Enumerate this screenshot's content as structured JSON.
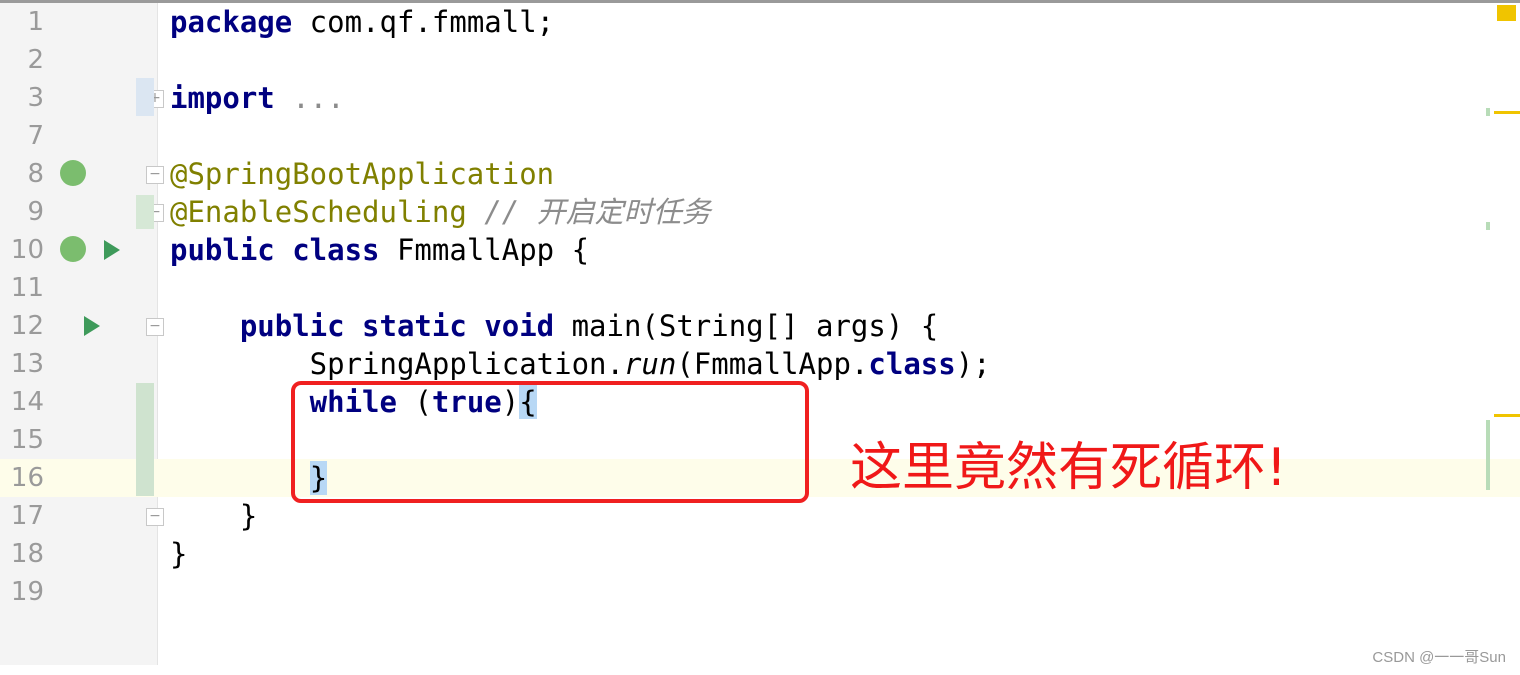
{
  "editor": {
    "lines": [
      {
        "n": "1",
        "tokens": [
          {
            "t": "package",
            "c": "kw"
          },
          {
            "t": " com.qf.fmmall;",
            "c": ""
          }
        ]
      },
      {
        "n": "2",
        "tokens": []
      },
      {
        "n": "3",
        "tokens": [
          {
            "t": "import",
            "c": "kw"
          },
          {
            "t": " ...",
            "c": "fold"
          }
        ]
      },
      {
        "n": "7",
        "tokens": []
      },
      {
        "n": "8",
        "tokens": [
          {
            "t": "@SpringBootApplication",
            "c": "ann"
          }
        ]
      },
      {
        "n": "9",
        "tokens": [
          {
            "t": "@EnableScheduling",
            "c": "ann"
          },
          {
            "t": " // 开启定时任务",
            "c": "cm"
          }
        ]
      },
      {
        "n": "10",
        "tokens": [
          {
            "t": "public class",
            "c": "kw"
          },
          {
            "t": " FmmallApp {",
            "c": ""
          }
        ]
      },
      {
        "n": "11",
        "tokens": []
      },
      {
        "n": "12",
        "tokens": [
          {
            "t": "    public static void",
            "c": "kw"
          },
          {
            "t": " main(String[] args) {",
            "c": ""
          }
        ]
      },
      {
        "n": "13",
        "tokens": [
          {
            "t": "        SpringApplication.",
            "c": ""
          },
          {
            "t": "run",
            "c": "it"
          },
          {
            "t": "(FmmallApp.",
            "c": ""
          },
          {
            "t": "class",
            "c": "kw"
          },
          {
            "t": ");",
            "c": ""
          }
        ]
      },
      {
        "n": "14",
        "tokens": [
          {
            "t": "        while",
            "c": "kw"
          },
          {
            "t": " (",
            "c": ""
          },
          {
            "t": "true",
            "c": "kw"
          },
          {
            "t": ")",
            "c": ""
          },
          {
            "t": "{",
            "c": "brace"
          }
        ]
      },
      {
        "n": "15",
        "tokens": []
      },
      {
        "n": "16",
        "tokens": [
          {
            "t": "        ",
            "c": ""
          },
          {
            "t": "}",
            "c": "brace"
          }
        ]
      },
      {
        "n": "17",
        "tokens": [
          {
            "t": "    }",
            "c": ""
          }
        ]
      },
      {
        "n": "18",
        "tokens": [
          {
            "t": "}",
            "c": ""
          }
        ]
      },
      {
        "n": "19",
        "tokens": []
      }
    ],
    "current_line": "16"
  },
  "annotation": {
    "text": "这里竟然有死循环!",
    "color": "#f01818"
  },
  "watermark": "CSDN @一一哥Sun"
}
